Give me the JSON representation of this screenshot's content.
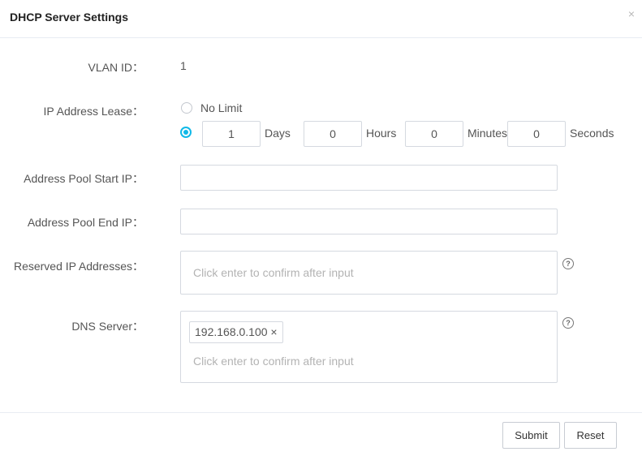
{
  "dialog": {
    "title": "DHCP Server Settings",
    "close_symbol": "×"
  },
  "vlan": {
    "label": "VLAN ID：",
    "value": "1"
  },
  "lease": {
    "label": "IP Address Lease：",
    "no_limit_label": "No Limit",
    "selected": "custom",
    "days": "1",
    "days_unit": "Days",
    "hours": "0",
    "hours_unit": "Hours",
    "minutes": "0",
    "minutes_unit": "Minutes",
    "seconds": "0",
    "seconds_unit": "Seconds"
  },
  "pool_start": {
    "label": "Address Pool Start IP：",
    "value": ""
  },
  "pool_end": {
    "label": "Address Pool End IP：",
    "value": ""
  },
  "reserved": {
    "label": "Reserved IP Addresses：",
    "placeholder": "Click enter to confirm after input",
    "help": "?"
  },
  "dns": {
    "label": "DNS Server：",
    "tags": [
      "192.168.0.100"
    ],
    "tag_remove": "×",
    "placeholder": "Click enter to confirm after input",
    "help": "?"
  },
  "footer": {
    "submit": "Submit",
    "reset": "Reset"
  },
  "colors": {
    "accent": "#10b9e8",
    "border": "#d5d9e0",
    "placeholder": "#b3b3b3"
  }
}
